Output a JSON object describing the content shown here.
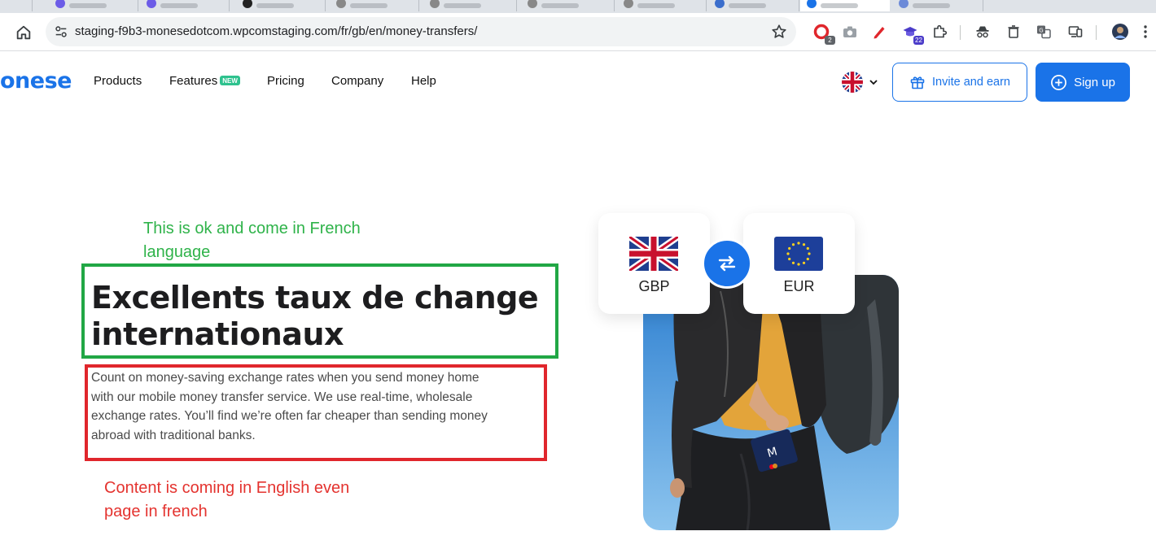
{
  "browser": {
    "address_url": "staging-f9b3-monesedotcom.wpcomstaging.com/fr/gb/en/money-transfers/",
    "extension_badges": [
      "2",
      "22"
    ]
  },
  "site": {
    "logo_text": "onese",
    "nav": [
      "Products",
      "Features",
      "Pricing",
      "Company",
      "Help"
    ],
    "features_badge": "NEW",
    "invite_label": "Invite and earn",
    "signup_label": "Sign up",
    "accent_color": "#1a73e8"
  },
  "hero": {
    "title_lines": [
      "Excellents taux de change",
      "internationaux"
    ],
    "body_lines": [
      "Count on money-saving exchange rates when you send money home",
      "with our mobile money transfer service. We use real-time, wholesale",
      "exchange rates. You’ll find we’re often far cheaper than sending money",
      "abroad with traditional banks."
    ],
    "currencies": [
      "GBP",
      "EUR"
    ]
  },
  "annotations": {
    "green_lines": [
      "This is ok and come in French",
      "language"
    ],
    "red_lines": [
      "Content is coming in English even",
      "page in french"
    ],
    "green_color": "#21a745",
    "red_color": "#e0262c"
  }
}
